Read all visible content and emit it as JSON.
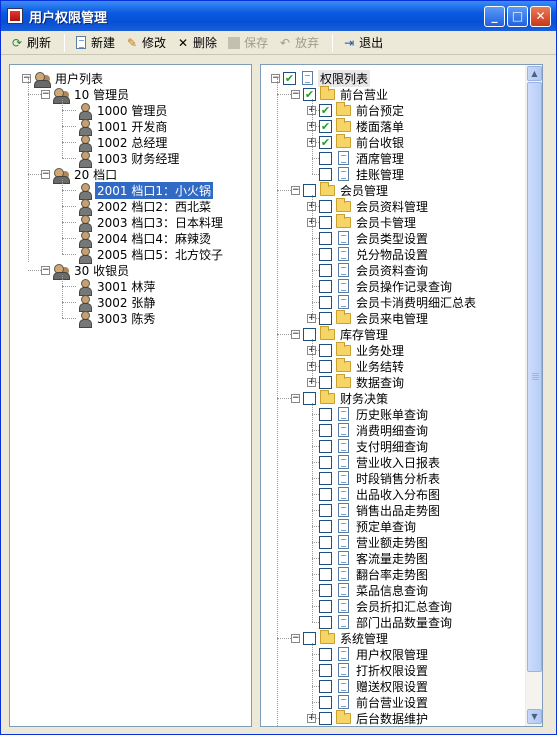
{
  "window": {
    "title": "用户权限管理",
    "minimize_glyph": "_",
    "maximize_glyph": "□",
    "close_glyph": "✕"
  },
  "toolbar": {
    "refresh": "刷新",
    "new": "新建",
    "modify": "修改",
    "delete": "删除",
    "save": "保存",
    "discard": "放弃",
    "exit": "退出"
  },
  "user_tree": {
    "root": "用户列表",
    "groups": [
      {
        "label": "10 管理员",
        "users": [
          "1000 管理员",
          "1001 开发商",
          "1002 总经理",
          "1003 财务经理"
        ]
      },
      {
        "label": "20 档口",
        "users": [
          "2001 档口1：小火锅",
          "2002 档口2：西北菜",
          "2003 档口3：日本料理",
          "2004 档口4：麻辣烫",
          "2005 档口5：北方饺子"
        ]
      },
      {
        "label": "30 收银员",
        "users": [
          "3001 林萍",
          "3002 张静",
          "3003 陈秀"
        ]
      }
    ],
    "selected": "2001 档口1：小火锅"
  },
  "perm_tree": {
    "root": "权限列表",
    "groups": [
      {
        "label": "前台营业",
        "checked": true,
        "items": [
          {
            "label": "前台预定",
            "checked": true,
            "folder": true
          },
          {
            "label": "楼面落单",
            "checked": true,
            "folder": true
          },
          {
            "label": "前台收银",
            "checked": true,
            "folder": true
          },
          {
            "label": "酒席管理",
            "checked": false,
            "folder": false
          },
          {
            "label": "挂账管理",
            "checked": false,
            "folder": false
          }
        ]
      },
      {
        "label": "会员管理",
        "checked": false,
        "items": [
          {
            "label": "会员资料管理",
            "checked": false,
            "folder": true
          },
          {
            "label": "会员卡管理",
            "checked": false,
            "folder": true
          },
          {
            "label": "会员类型设置",
            "checked": false,
            "folder": false
          },
          {
            "label": "兑分物品设置",
            "checked": false,
            "folder": false
          },
          {
            "label": "会员资料查询",
            "checked": false,
            "folder": false
          },
          {
            "label": "会员操作记录查询",
            "checked": false,
            "folder": false
          },
          {
            "label": "会员卡消费明细汇总表",
            "checked": false,
            "folder": false
          },
          {
            "label": "会员来电管理",
            "checked": false,
            "folder": true
          }
        ]
      },
      {
        "label": "库存管理",
        "checked": false,
        "items": [
          {
            "label": "业务处理",
            "checked": false,
            "folder": true
          },
          {
            "label": "业务结转",
            "checked": false,
            "folder": true
          },
          {
            "label": "数据查询",
            "checked": false,
            "folder": true
          }
        ]
      },
      {
        "label": "财务决策",
        "checked": false,
        "items": [
          {
            "label": "历史账单查询",
            "checked": false,
            "folder": false
          },
          {
            "label": "消费明细查询",
            "checked": false,
            "folder": false
          },
          {
            "label": "支付明细查询",
            "checked": false,
            "folder": false
          },
          {
            "label": "营业收入日报表",
            "checked": false,
            "folder": false
          },
          {
            "label": "时段销售分析表",
            "checked": false,
            "folder": false
          },
          {
            "label": "出品收入分布图",
            "checked": false,
            "folder": false
          },
          {
            "label": "销售出品走势图",
            "checked": false,
            "folder": false
          },
          {
            "label": "预定单查询",
            "checked": false,
            "folder": false
          },
          {
            "label": "营业额走势图",
            "checked": false,
            "folder": false
          },
          {
            "label": "客流量走势图",
            "checked": false,
            "folder": false
          },
          {
            "label": "翻台率走势图",
            "checked": false,
            "folder": false
          },
          {
            "label": "菜品信息查询",
            "checked": false,
            "folder": false
          },
          {
            "label": "会员折扣汇总查询",
            "checked": false,
            "folder": false
          },
          {
            "label": "部门出品数量查询",
            "checked": false,
            "folder": false
          }
        ]
      },
      {
        "label": "系统管理",
        "checked": false,
        "items": [
          {
            "label": "用户权限管理",
            "checked": false,
            "folder": false
          },
          {
            "label": "打折权限设置",
            "checked": false,
            "folder": false
          },
          {
            "label": "赠送权限设置",
            "checked": false,
            "folder": false
          },
          {
            "label": "前台营业设置",
            "checked": false,
            "folder": false
          },
          {
            "label": "后台数据维护",
            "checked": false,
            "folder": true
          }
        ]
      }
    ]
  },
  "colors": {
    "selection": "#316ac5",
    "title_bar": "#0a5ae0",
    "check": "#21a121"
  }
}
